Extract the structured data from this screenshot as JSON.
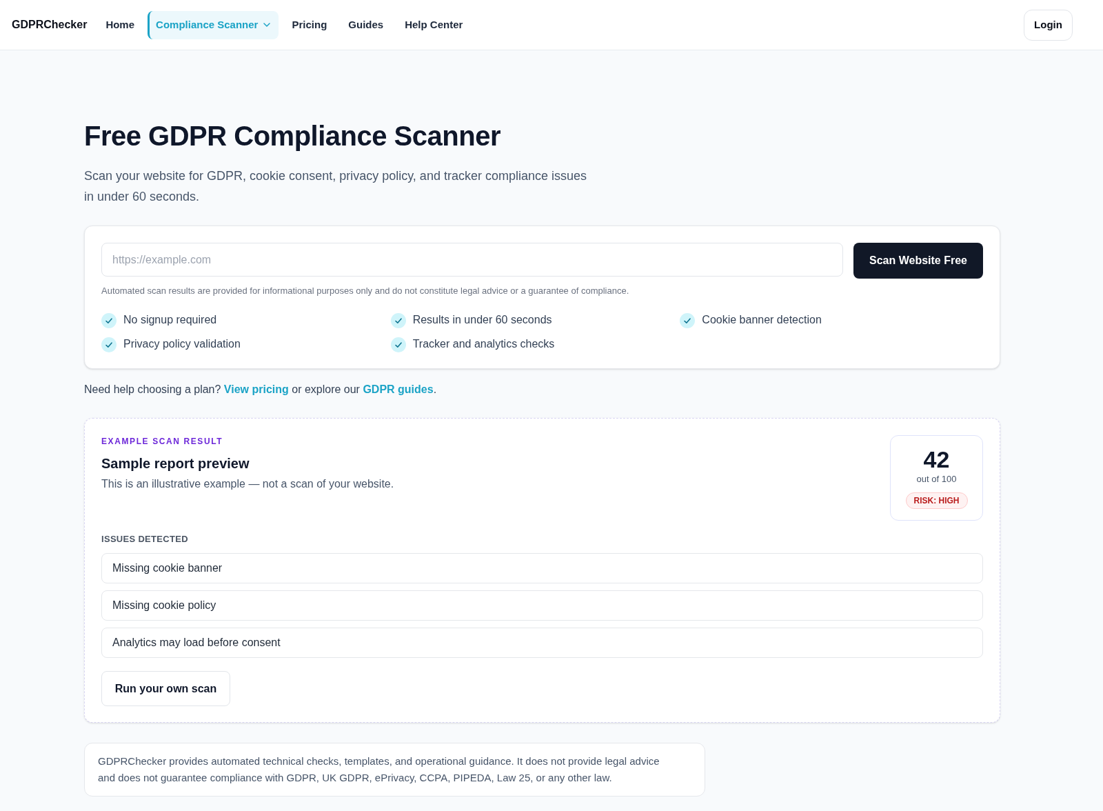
{
  "header": {
    "logo": "GDPRChecker",
    "nav": [
      {
        "label": "Home",
        "kind": "link",
        "selected": false
      },
      {
        "label": "Compliance Scanner",
        "kind": "dropdown",
        "selected": true
      },
      {
        "label": "Pricing",
        "kind": "link",
        "selected": false
      },
      {
        "label": "Guides",
        "kind": "link",
        "selected": false
      },
      {
        "label": "Help Center",
        "kind": "link",
        "selected": false
      }
    ],
    "login": "Login"
  },
  "hero": {
    "title": "Free GDPR Compliance Scanner",
    "subtitle": "Scan your website for GDPR, cookie consent, privacy policy, and tracker compliance issues in under 60 seconds."
  },
  "scan_form": {
    "url_field": {
      "placeholder": "https://example.com"
    },
    "button": "Scan Website Free",
    "disclaimer": "Automated scan results are provided for informational purposes only and do not constitute legal advice or a guarantee of compliance.",
    "features": [
      "No signup required",
      "Results in under 60 seconds",
      "Cookie banner detection",
      "Privacy policy validation",
      "Tracker and analytics checks"
    ]
  },
  "help_line": [
    {
      "kind": "text",
      "text": "Need help choosing a plan? "
    },
    {
      "kind": "link",
      "text": "View pricing"
    },
    {
      "kind": "text",
      "text": " or explore our "
    },
    {
      "kind": "link",
      "text": "GDPR guides"
    },
    {
      "kind": "text",
      "text": "."
    }
  ],
  "sample_report": {
    "eyebrow": "EXAMPLE SCAN RESULT",
    "title": "Sample report preview",
    "description": "This is an illustrative example — not a scan of your website.",
    "score": {
      "value": "42",
      "caption": "out of 100",
      "risk": "RISK: HIGH"
    },
    "issues_heading": "ISSUES DETECTED",
    "issues": [
      "Missing cookie banner",
      "Missing cookie policy",
      "Analytics may load before consent"
    ],
    "button": "Run your own scan"
  },
  "notice": "GDPRChecker provides automated technical checks, templates, and operational guidance. It does not provide legal advice and does not guarantee compliance with GDPR, UK GDPR, ePrivacy, CCPA, PIPEDA, Law 25, or any other law."
}
